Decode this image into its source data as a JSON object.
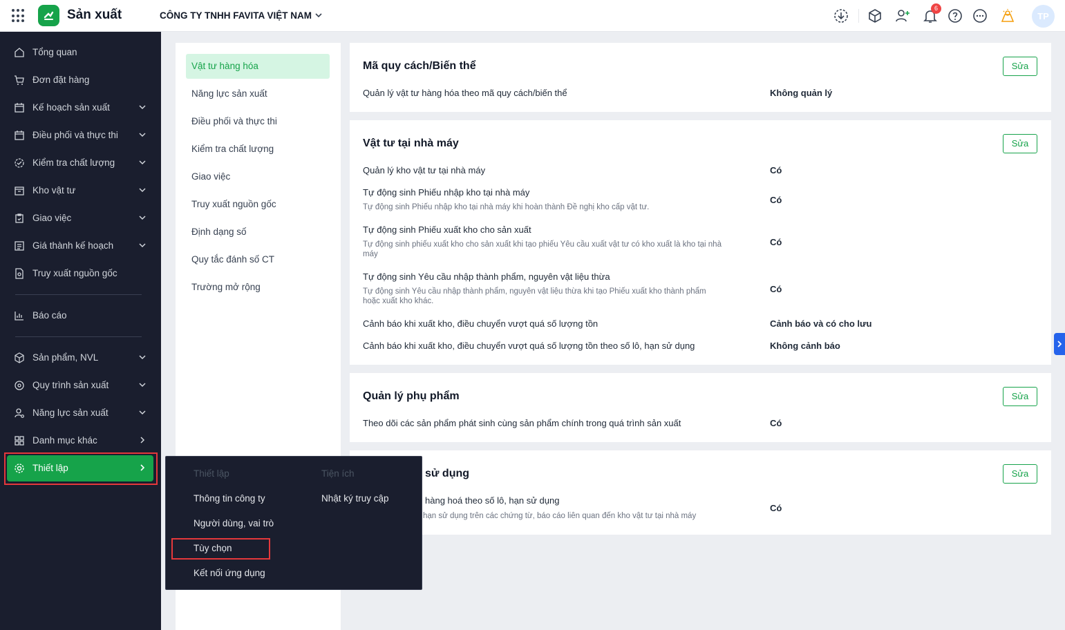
{
  "header": {
    "app_title": "Sản xuất",
    "company": "CÔNG TY TNHH FAVITA VIỆT NAM",
    "notification_count": "6",
    "avatar_initials": "TP",
    "brand_color": "#16a34a"
  },
  "sidebar": {
    "items": [
      {
        "label": "Tổng quan",
        "icon": "home-icon"
      },
      {
        "label": "Đơn đặt hàng",
        "icon": "cart-icon"
      },
      {
        "label": "Kế hoạch sản xuất",
        "icon": "calendar-icon"
      },
      {
        "label": "Điều phối và thực thi",
        "icon": "calendar-clock-icon"
      },
      {
        "label": "Kiểm tra chất lượng",
        "icon": "check-circle-icon"
      },
      {
        "label": "Kho vật tư",
        "icon": "warehouse-icon"
      },
      {
        "label": "Giao việc",
        "icon": "clipboard-icon"
      },
      {
        "label": "Giá thành kế hoạch",
        "icon": "price-icon"
      },
      {
        "label": "Truy xuất nguồn gốc",
        "icon": "doc-search-icon"
      },
      {
        "label": "Báo cáo",
        "icon": "chart-icon"
      },
      {
        "label": "Sản phẩm, NVL",
        "icon": "box-icon"
      },
      {
        "label": "Quy trình sản xuất",
        "icon": "process-icon"
      },
      {
        "label": "Năng lực sản xuất",
        "icon": "user-gear-icon"
      },
      {
        "label": "Danh mục khác",
        "icon": "grid-icon"
      },
      {
        "label": "Thiết lập",
        "icon": "gear-icon"
      }
    ]
  },
  "subnav": {
    "items": [
      "Vật tư hàng hóa",
      "Năng lực sản xuất",
      "Điều phối và thực thi",
      "Kiểm tra chất lượng",
      "Giao việc",
      "Truy xuất nguồn gốc",
      "Định dạng số",
      "Quy tắc đánh số CT",
      "Trường mở rộng"
    ]
  },
  "cards": [
    {
      "title": "Mã quy cách/Biến thể",
      "edit_label": "Sửa",
      "rows": [
        {
          "label": "Quản lý vật tư hàng hóa theo mã quy cách/biến thể",
          "value": "Không quản lý"
        }
      ]
    },
    {
      "title": "Vật tư tại nhà máy",
      "edit_label": "Sửa",
      "rows": [
        {
          "label": "Quản lý kho vật tư tại nhà máy",
          "value": "Có"
        },
        {
          "label": "Tự động sinh Phiếu nhập kho tại nhà máy",
          "desc": "Tự động sinh Phiếu nhập kho tại nhà máy khi hoàn thành Đề nghị kho cấp vật tư.",
          "value": "Có"
        },
        {
          "label": "Tự động sinh Phiếu xuất kho cho sản xuất",
          "desc": "Tự động sinh phiếu xuất kho cho sản xuất khi tạo phiếu Yêu cầu xuất vật tư có kho xuất là kho tại nhà máy",
          "value": "Có"
        },
        {
          "label": "Tự động sinh Yêu cầu nhập thành phẩm, nguyên vật liệu thừa",
          "desc": "Tự động sinh Yêu cầu nhập thành phẩm, nguyên vật liệu thừa khi tạo Phiếu xuất kho thành phẩm hoặc xuất kho khác.",
          "value": "Có"
        },
        {
          "label": "Cảnh báo khi xuất kho, điều chuyển vượt quá số lượng tồn",
          "value": "Cảnh báo và có cho lưu"
        },
        {
          "label": "Cảnh báo khi xuất kho, điều chuyển vượt quá số lượng tồn theo số lô, hạn sử dụng",
          "value": "Không cảnh báo"
        }
      ]
    },
    {
      "title": "Quản lý phụ phẩm",
      "edit_label": "Sửa",
      "rows": [
        {
          "label": "Theo dõi các sản phẩm phát sinh cùng sản phẩm chính trong quá trình sản xuất",
          "value": "Có"
        }
      ]
    },
    {
      "title": "sử dụng",
      "edit_label": "Sửa",
      "rows": [
        {
          "label": "hàng hoá theo số lô, hạn sử dụng",
          "desc": "hạn sử dụng trên các chứng từ, báo cáo liên quan đến kho vật tư tại nhà máy",
          "value": "Có"
        }
      ]
    }
  ],
  "popup": {
    "col1_header": "Thiết lập",
    "col1_items": [
      "Thông tin công ty",
      "Người dùng, vai trò",
      "Tùy chọn",
      "Kết nối ứng dụng"
    ],
    "col2_header": "Tiện ích",
    "col2_items": [
      "Nhật ký truy cập"
    ]
  }
}
